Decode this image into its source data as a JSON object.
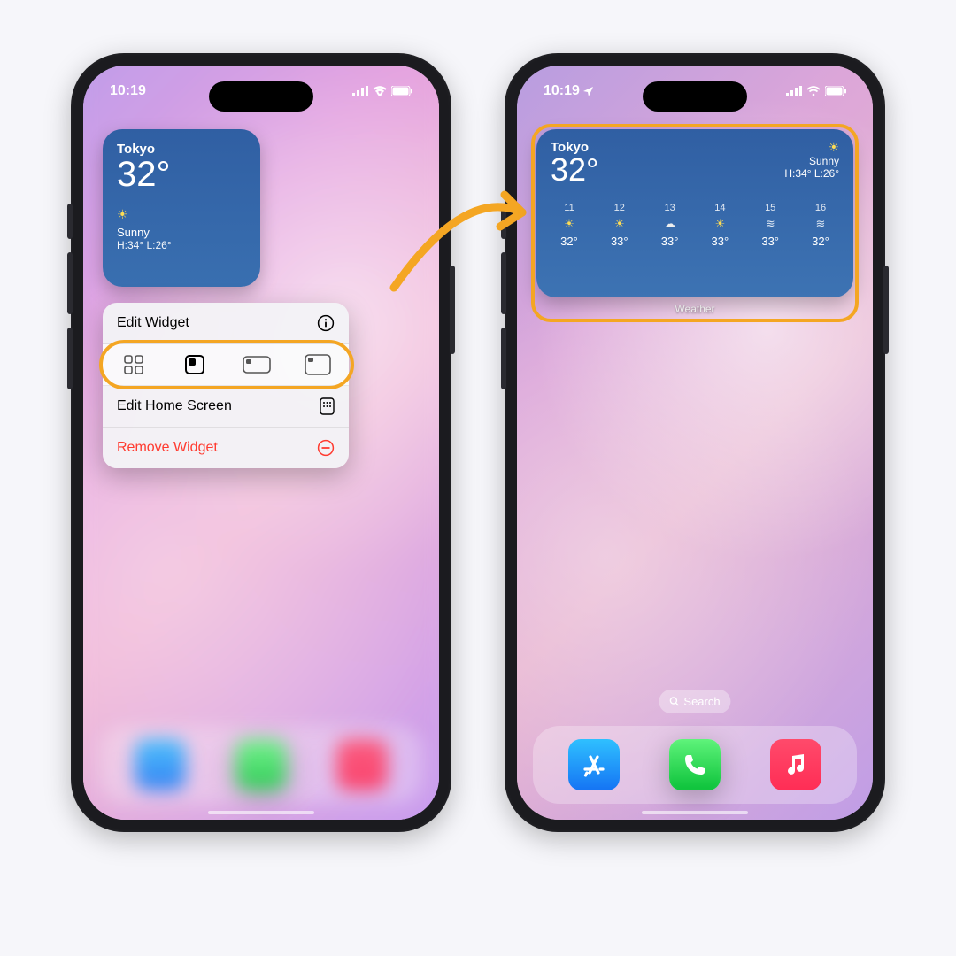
{
  "status": {
    "time": "10:19"
  },
  "weather_small": {
    "location": "Tokyo",
    "temp": "32°",
    "condition": "Sunny",
    "hi_lo": "H:34° L:26°"
  },
  "menu": {
    "edit_widget": "Edit Widget",
    "edit_home": "Edit Home Screen",
    "remove": "Remove Widget"
  },
  "weather_med": {
    "location": "Tokyo",
    "temp": "32°",
    "condition": "Sunny",
    "hi_lo": "H:34° L:26°",
    "label": "Weather",
    "hours": [
      {
        "h": "11",
        "icon": "sun",
        "t": "32°"
      },
      {
        "h": "12",
        "icon": "sun",
        "t": "33°"
      },
      {
        "h": "13",
        "icon": "cloud",
        "t": "33°"
      },
      {
        "h": "14",
        "icon": "sun",
        "t": "33°"
      },
      {
        "h": "15",
        "icon": "wind",
        "t": "33°"
      },
      {
        "h": "16",
        "icon": "wind",
        "t": "32°"
      }
    ]
  },
  "search": {
    "label": "Search"
  },
  "colors": {
    "highlight": "#f4a623",
    "danger": "#ff3b30"
  }
}
